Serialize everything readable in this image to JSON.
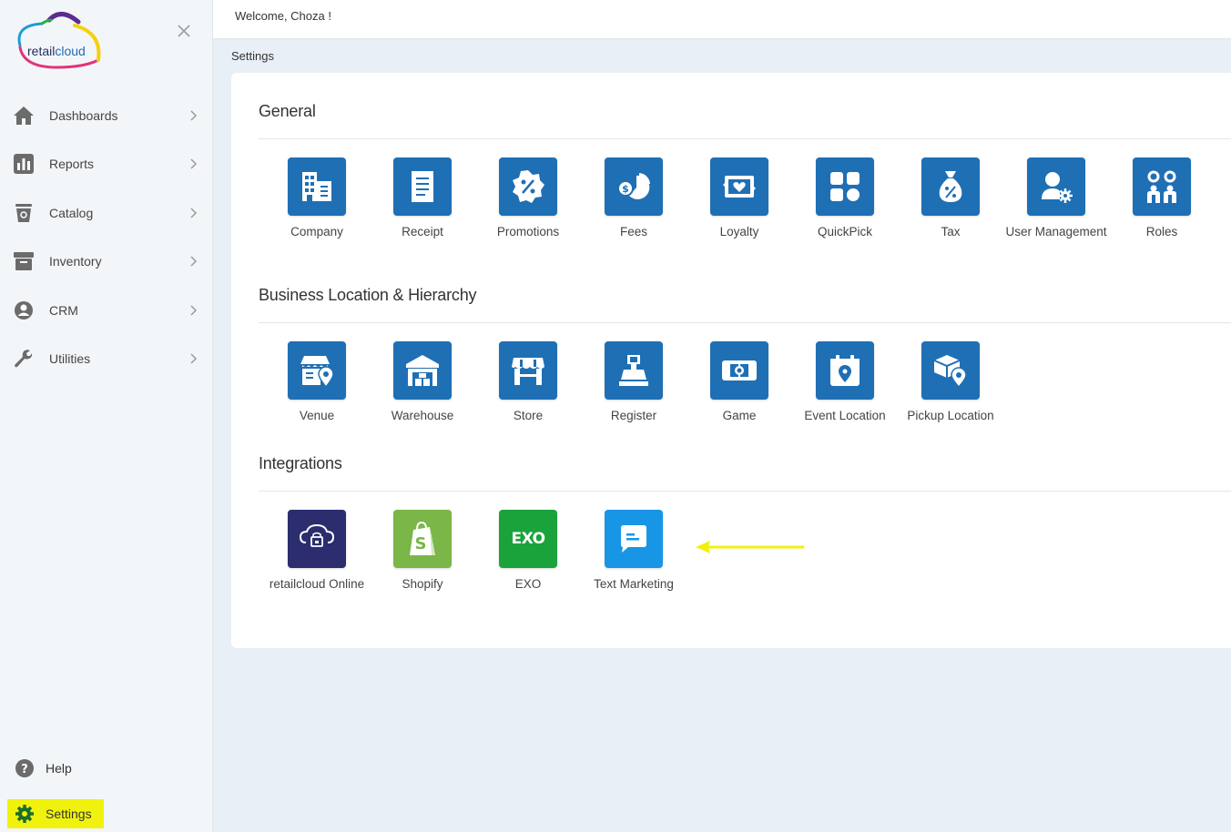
{
  "header": {
    "welcome": "Welcome, Choza !"
  },
  "breadcrumb": "Settings",
  "logo": {
    "text_a": "retail",
    "text_b": "cloud"
  },
  "sidebar": {
    "items": [
      {
        "label": "Dashboards",
        "icon": "home-icon"
      },
      {
        "label": "Reports",
        "icon": "bar-chart-icon"
      },
      {
        "label": "Catalog",
        "icon": "bucket-icon"
      },
      {
        "label": "Inventory",
        "icon": "archive-box-icon"
      },
      {
        "label": "CRM",
        "icon": "user-gear-icon"
      },
      {
        "label": "Utilities",
        "icon": "wrench-icon"
      }
    ],
    "help": "Help",
    "settings": "Settings"
  },
  "sections": {
    "general": {
      "title": "General",
      "tiles": [
        {
          "label": "Company",
          "icon": "building-icon"
        },
        {
          "label": "Receipt",
          "icon": "receipt-icon"
        },
        {
          "label": "Promotions",
          "icon": "promo-badge-icon"
        },
        {
          "label": "Fees",
          "icon": "fees-pie-icon"
        },
        {
          "label": "Loyalty",
          "icon": "loyalty-card-icon"
        },
        {
          "label": "QuickPick",
          "icon": "grid-icon"
        },
        {
          "label": "Tax",
          "icon": "tax-bag-icon"
        },
        {
          "label": "User Management",
          "icon": "user-settings-icon"
        },
        {
          "label": "Roles",
          "icon": "roles-gears-icon"
        }
      ]
    },
    "business": {
      "title": "Business Location & Hierarchy",
      "tiles": [
        {
          "label": "Venue",
          "icon": "venue-icon"
        },
        {
          "label": "Warehouse",
          "icon": "warehouse-icon"
        },
        {
          "label": "Store",
          "icon": "store-icon"
        },
        {
          "label": "Register",
          "icon": "register-icon"
        },
        {
          "label": "Game",
          "icon": "game-icon"
        },
        {
          "label": "Event Location",
          "icon": "event-location-icon"
        },
        {
          "label": "Pickup Location",
          "icon": "pickup-location-icon"
        }
      ]
    },
    "integrations": {
      "title": "Integrations",
      "tiles": [
        {
          "label": "retailcloud Online",
          "icon": "retailcloud-online-icon",
          "color": "#2b2d6e"
        },
        {
          "label": "Shopify",
          "icon": "shopify-icon",
          "color": "#7ab648"
        },
        {
          "label": "EXO",
          "icon": "exo-icon",
          "color": "#1aa33a",
          "logo_text": "EXO"
        },
        {
          "label": "Text Marketing",
          "icon": "chat-bubble-icon",
          "color": "#1796e6"
        }
      ]
    }
  },
  "colors": {
    "tile_blue": "#1f6fb5",
    "highlight_yellow": "#f0f20d",
    "arrow_yellow": "#f3f00c"
  }
}
